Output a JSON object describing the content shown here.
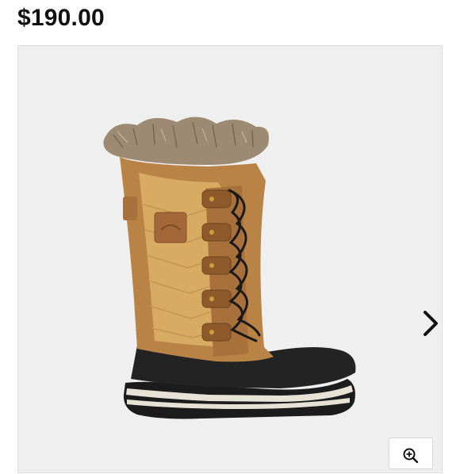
{
  "product": {
    "price": "$190.00"
  },
  "gallery": {
    "background": "#efefef",
    "image": "boot-image",
    "next_icon": "chevron-right-icon",
    "zoom_icon": "zoom-in-icon"
  }
}
